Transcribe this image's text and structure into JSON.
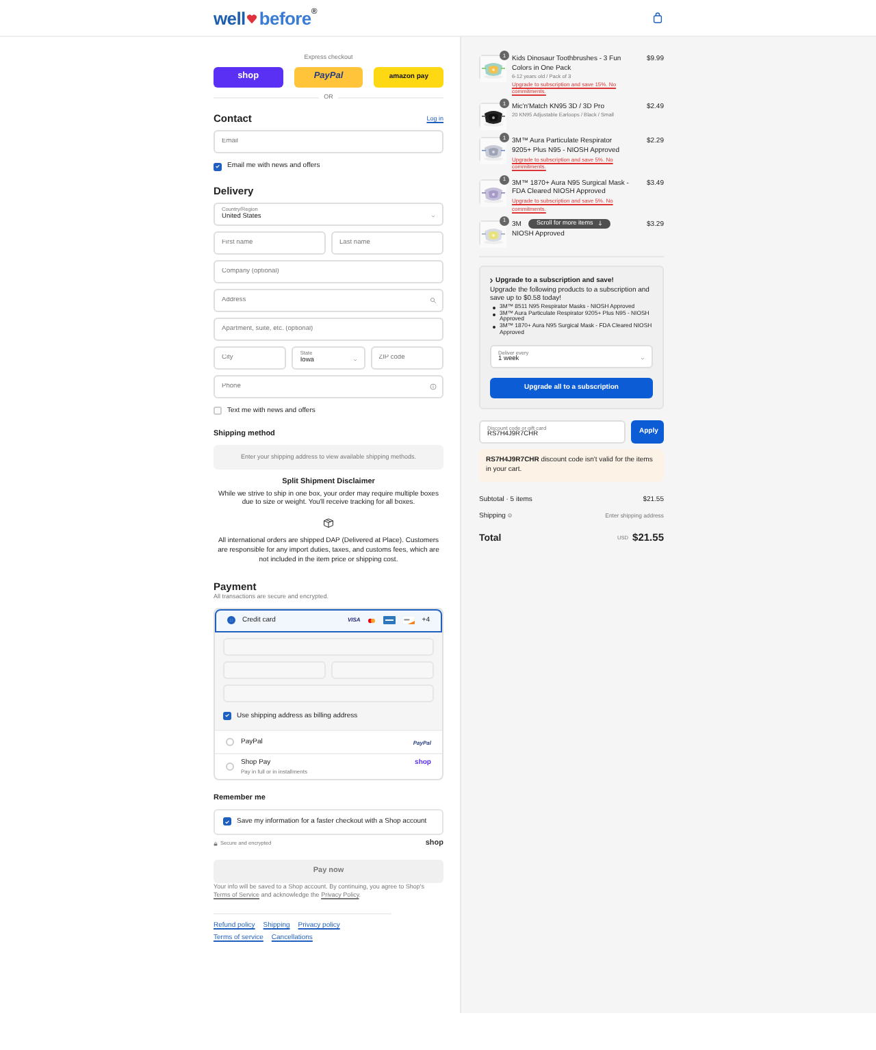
{
  "header": {
    "logo": {
      "left": "well",
      "right": "before",
      "mark": "®"
    }
  },
  "express_checkout": {
    "label": "Express checkout",
    "buttons": [
      {
        "kind": "shop",
        "label": "shop"
      },
      {
        "kind": "paypal",
        "label": "PayPal"
      },
      {
        "kind": "amazon",
        "label": "amazon pay"
      }
    ],
    "divider": "OR"
  },
  "contact": {
    "title": "Contact",
    "login": "Log in",
    "email_placeholder": "Email",
    "newsletter": {
      "label": "Email me with news and offers",
      "checked": true
    }
  },
  "delivery": {
    "title": "Delivery",
    "rows": [
      [
        {
          "kind": "select",
          "label": "Country/Region",
          "value": "United States"
        }
      ],
      [
        {
          "kind": "input",
          "placeholder": "First name"
        },
        {
          "kind": "input",
          "placeholder": "Last name"
        }
      ],
      [
        {
          "kind": "input",
          "placeholder": "Company (optional)"
        }
      ],
      [
        {
          "kind": "search",
          "placeholder": "Address"
        }
      ],
      [
        {
          "kind": "input",
          "placeholder": "Apartment, suite, etc. (optional)"
        }
      ],
      [
        {
          "kind": "input",
          "placeholder": "City"
        },
        {
          "kind": "select",
          "label": "State",
          "value": "Iowa"
        },
        {
          "kind": "input",
          "placeholder": "ZIP code"
        }
      ],
      [
        {
          "kind": "help",
          "placeholder": "Phone"
        }
      ]
    ],
    "sms": {
      "label": "Text me with news and offers",
      "checked": false
    }
  },
  "shipping_method": {
    "title": "Shipping method",
    "message": "Enter your shipping address to view available shipping methods."
  },
  "disclaimer": {
    "title": "Split Shipment Disclaimer",
    "text": "While we strive to ship in one box, your order may require multiple boxes due to size or weight. You'll receive tracking for all boxes.",
    "note": "All international orders are shipped DAP (Delivered at Place). Customers are responsible for any import duties, taxes, and customs fees, which are not included in the item price or shipping cost."
  },
  "payment": {
    "title": "Payment",
    "subtitle": "All transactions are secure and encrypted.",
    "methods": [
      {
        "kind": "card",
        "label": "Credit card",
        "selected": true,
        "visa": "VISA",
        "more": "+4",
        "billing": {
          "label": "Use shipping address as billing address",
          "checked": true
        }
      },
      {
        "kind": "paypal",
        "label": "PayPal",
        "selected": false,
        "logo": "PayPal"
      },
      {
        "kind": "shoppay",
        "label": "Shop Pay",
        "note": "Pay in full or in installments",
        "selected": false,
        "logo": "shop"
      }
    ]
  },
  "remember": {
    "title": "Remember me",
    "label": "Save my information for a faster checkout with a Shop account",
    "checked": true,
    "secure": "Secure and encrypted",
    "brand": "shop"
  },
  "pay_button": {
    "label": "Pay now",
    "disabled": true
  },
  "legal": [
    {
      "text": "Your info will be saved to a Shop account. By continuing, you agree to Shop's "
    },
    {
      "link": "Terms of Service"
    },
    {
      "text": " and acknowledge the "
    },
    {
      "link": "Privacy Policy"
    },
    {
      "text": "."
    }
  ],
  "footer_links": [
    "Refund policy",
    "Shipping",
    "Privacy policy",
    "Terms of service",
    "Cancellations"
  ],
  "cart_items": [
    {
      "quantity": "1",
      "name": "Kids Dinosaur Toothbrushes - 3 Fun Colors in One Pack",
      "variant": "6-12 years old / Pack of 3",
      "upgrade": "Upgrade to subscription and save 15%. No commitments.",
      "price": "$9.99"
    },
    {
      "quantity": "1",
      "name": "Mic'n'Match KN95 3D / 3D Pro",
      "variant": "20 KN95 Adjustable Earloops / Black / Small",
      "price": "$2.49"
    },
    {
      "quantity": "1",
      "name": "3M™ Aura Particulate Respirator 9205+ Plus N95 - NIOSH Approved",
      "upgrade": "Upgrade to subscription and save 5%. No commitments.",
      "price": "$2.29"
    },
    {
      "quantity": "1",
      "name": "3M™ 1870+ Aura N95 Surgical Mask - FDA Cleared NIOSH Approved",
      "upgrade": "Upgrade to subscription and save 5%. No commitments.",
      "price": "$3.49"
    },
    {
      "quantity": "1",
      "name": "3M",
      "name_line_2": "NIOSH Approved",
      "price": "$3.29"
    }
  ],
  "scroll_hint": "Scroll for more items",
  "upgrade_box": {
    "title": "Upgrade to a subscription and save!",
    "text": "Upgrade the following products to a subscription and save up to $0.58 today!",
    "products": [
      "3M™ 8511 N95 Respirator Masks - NIOSH Approved",
      "3M™ Aura Particulate Respirator 9205+ Plus N95 - NIOSH Approved",
      "3M™ 1870+ Aura N95 Surgical Mask - FDA Cleared NIOSH Approved"
    ],
    "select_label": "Deliver every",
    "select_value": "1 week",
    "button": "Upgrade all to a subscription"
  },
  "discount": {
    "label": "Discount code or gift card",
    "value": "RS7H4J9R7CHR",
    "button": "Apply",
    "error": "**RS7H4J9R7CHR** discount code isn't valid for the items in your cart."
  },
  "totals": {
    "subtotal_label": "Subtotal · 5 items",
    "subtotal": "$21.55",
    "shipping_label": "Shipping",
    "shipping": "Enter shipping address",
    "total_label": "Total",
    "currency": "USD",
    "total": "$21.55"
  }
}
